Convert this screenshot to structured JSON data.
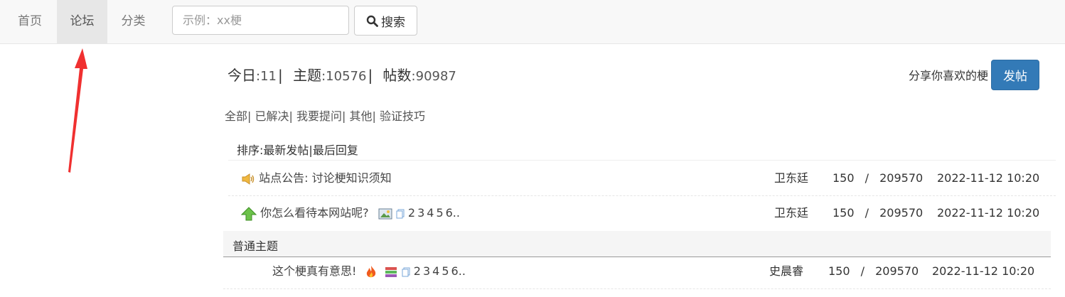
{
  "nav": {
    "items": [
      {
        "label": "首页"
      },
      {
        "label": "论坛"
      },
      {
        "label": "分类"
      }
    ],
    "search_placeholder": "示例：xx梗",
    "search_button": "搜索"
  },
  "stats": {
    "today_label": "今日",
    "today_value": "11",
    "topics_label": "主题",
    "topics_value": "10576",
    "posts_label": "帖数",
    "posts_value": "90987"
  },
  "share_text": "分享你喜欢的梗",
  "post_button": "发帖",
  "filters": [
    "全部",
    "已解决",
    "我要提问",
    "其他",
    "验证技巧"
  ],
  "sort": {
    "label": "排序:",
    "newest": "最新发帖",
    "last_reply": "最后回复"
  },
  "pinned": [
    {
      "icon": "megaphone-icon",
      "title": "站点公告: 讨论梗知识须知",
      "author": "卫东廷",
      "replies": "150",
      "views": "209570",
      "time": "2022-11-12 10:20"
    },
    {
      "icon": "up-arrow-icon",
      "title": "你怎么看待本网站呢?",
      "author": "卫东廷",
      "replies": "150",
      "views": "209570",
      "time": "2022-11-12 10:20",
      "pages": [
        "2",
        "3",
        "4",
        "5",
        "6.."
      ]
    }
  ],
  "section_title": "普通主题",
  "threads": [
    {
      "title": "这个梗真有意思!",
      "author": "史晨睿",
      "replies": "150",
      "views": "209570",
      "time": "2022-11-12 10:20",
      "pages": [
        "2",
        "3",
        "4",
        "5",
        "6.."
      ]
    }
  ],
  "count_separator": "/",
  "colors": {
    "primary": "#337ab7",
    "arrow": "#f03030"
  }
}
